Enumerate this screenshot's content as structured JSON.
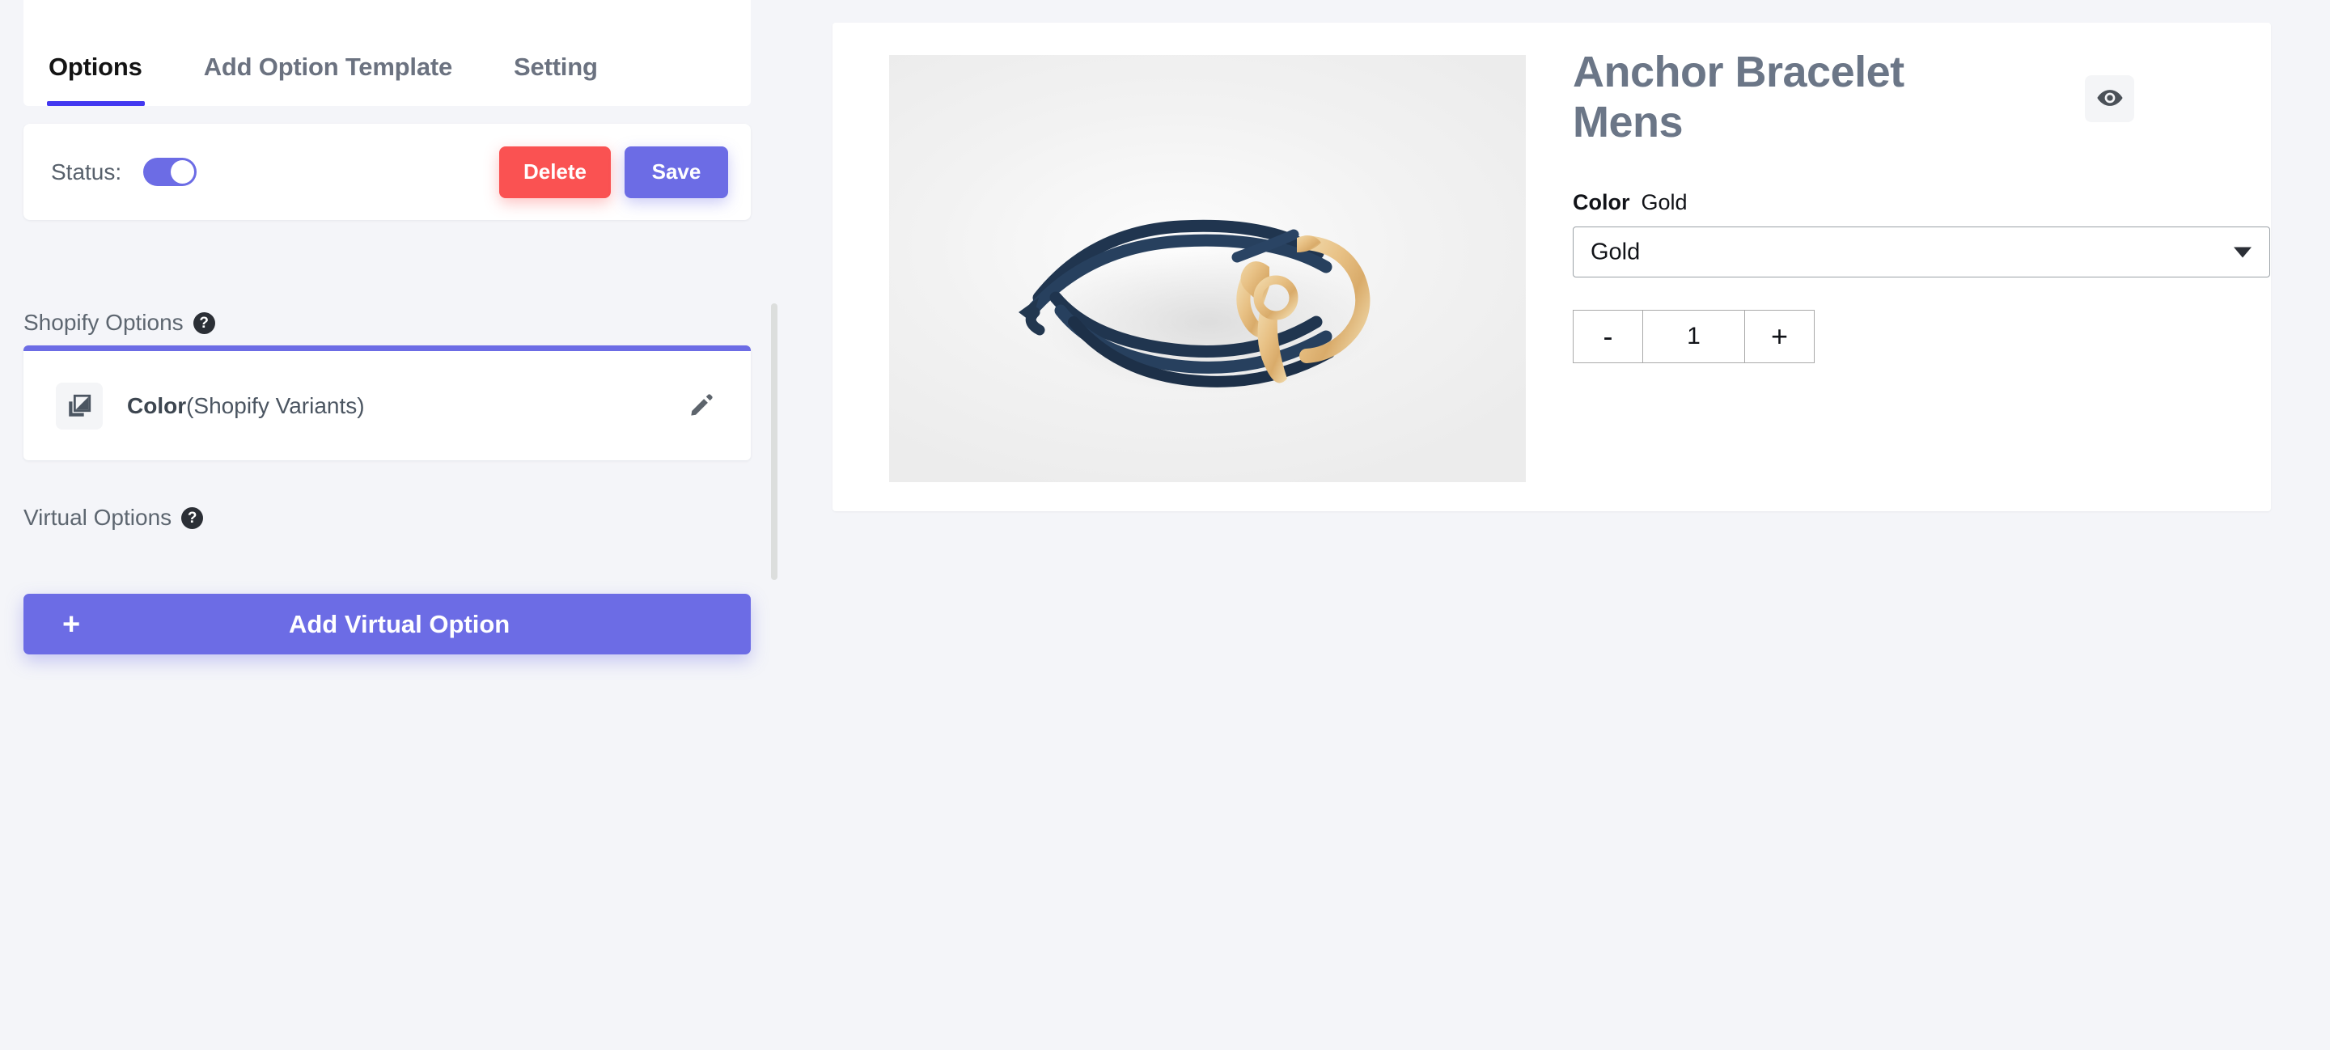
{
  "theme": {
    "page_background": "#f4f5f9",
    "accent": "#6c6ce5",
    "active_tab_underline": "#4338f0",
    "danger": "#fa5252",
    "card_background": "#ffffff",
    "heading_text": "#5d6670",
    "product_title_text": "#6b7687"
  },
  "tabs": [
    {
      "label": "Options",
      "active": true
    },
    {
      "label": "Add Option Template",
      "active": false
    },
    {
      "label": "Setting",
      "active": false
    }
  ],
  "status_card": {
    "label": "Status:",
    "toggle_state": "on",
    "delete_label": "Delete",
    "save_label": "Save"
  },
  "shopify_options": {
    "heading": "Shopify Options",
    "help_badge": "?",
    "rows": [
      {
        "icon": "layers-icon",
        "name": "Color",
        "source": "(Shopify Variants)",
        "edit_icon": "pencil-icon"
      }
    ]
  },
  "virtual_options": {
    "heading": "Virtual Options",
    "help_badge": "?",
    "add_button_plus": "+",
    "add_button_label": "Add Virtual Option"
  },
  "preview": {
    "product_title": "Anchor Bracelet Mens",
    "eye_icon": "eye-icon",
    "image_alt": "navy leather wrap bracelet with gold anchor clasp",
    "variant": {
      "label": "Color",
      "selected_value": "Gold",
      "select_value": "Gold",
      "caret_icon": "chevron-down-icon"
    },
    "quantity": {
      "decrement_label": "-",
      "value": "1",
      "increment_label": "+"
    }
  }
}
